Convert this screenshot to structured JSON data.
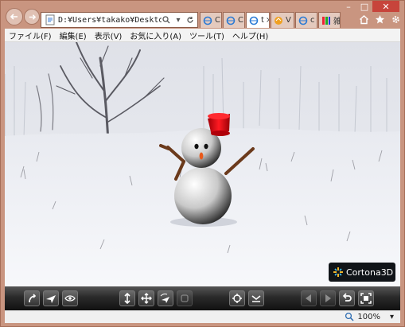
{
  "address_bar": {
    "url": "D:¥Users¥takako¥Desktop¥test.wrl"
  },
  "tabs": [
    {
      "label": "C",
      "active": false
    },
    {
      "label": "C",
      "active": false
    },
    {
      "label": "t",
      "active": true,
      "close": "×"
    },
    {
      "label": "V",
      "active": false
    },
    {
      "label": "c",
      "active": false
    },
    {
      "label": "雑",
      "active": false
    }
  ],
  "window_controls": {
    "minimize": "–",
    "maximize": "□",
    "close": "✕"
  },
  "menu": {
    "items": [
      "ファイル(F)",
      "編集(E)",
      "表示(V)",
      "お気に入り(A)",
      "ツール(T)",
      "ヘルプ(H)"
    ]
  },
  "viewer": {
    "brand": "Cortona3D",
    "snowman": {
      "hat_color": "#e8121a",
      "arm_color": "#6b3a1c",
      "nose_color": "#e85a1c"
    }
  },
  "status": {
    "zoom": "100%"
  },
  "colors": {
    "frame": "#c99580",
    "accent_close": "#c7443b",
    "toolbar": "#2a2a2a"
  }
}
